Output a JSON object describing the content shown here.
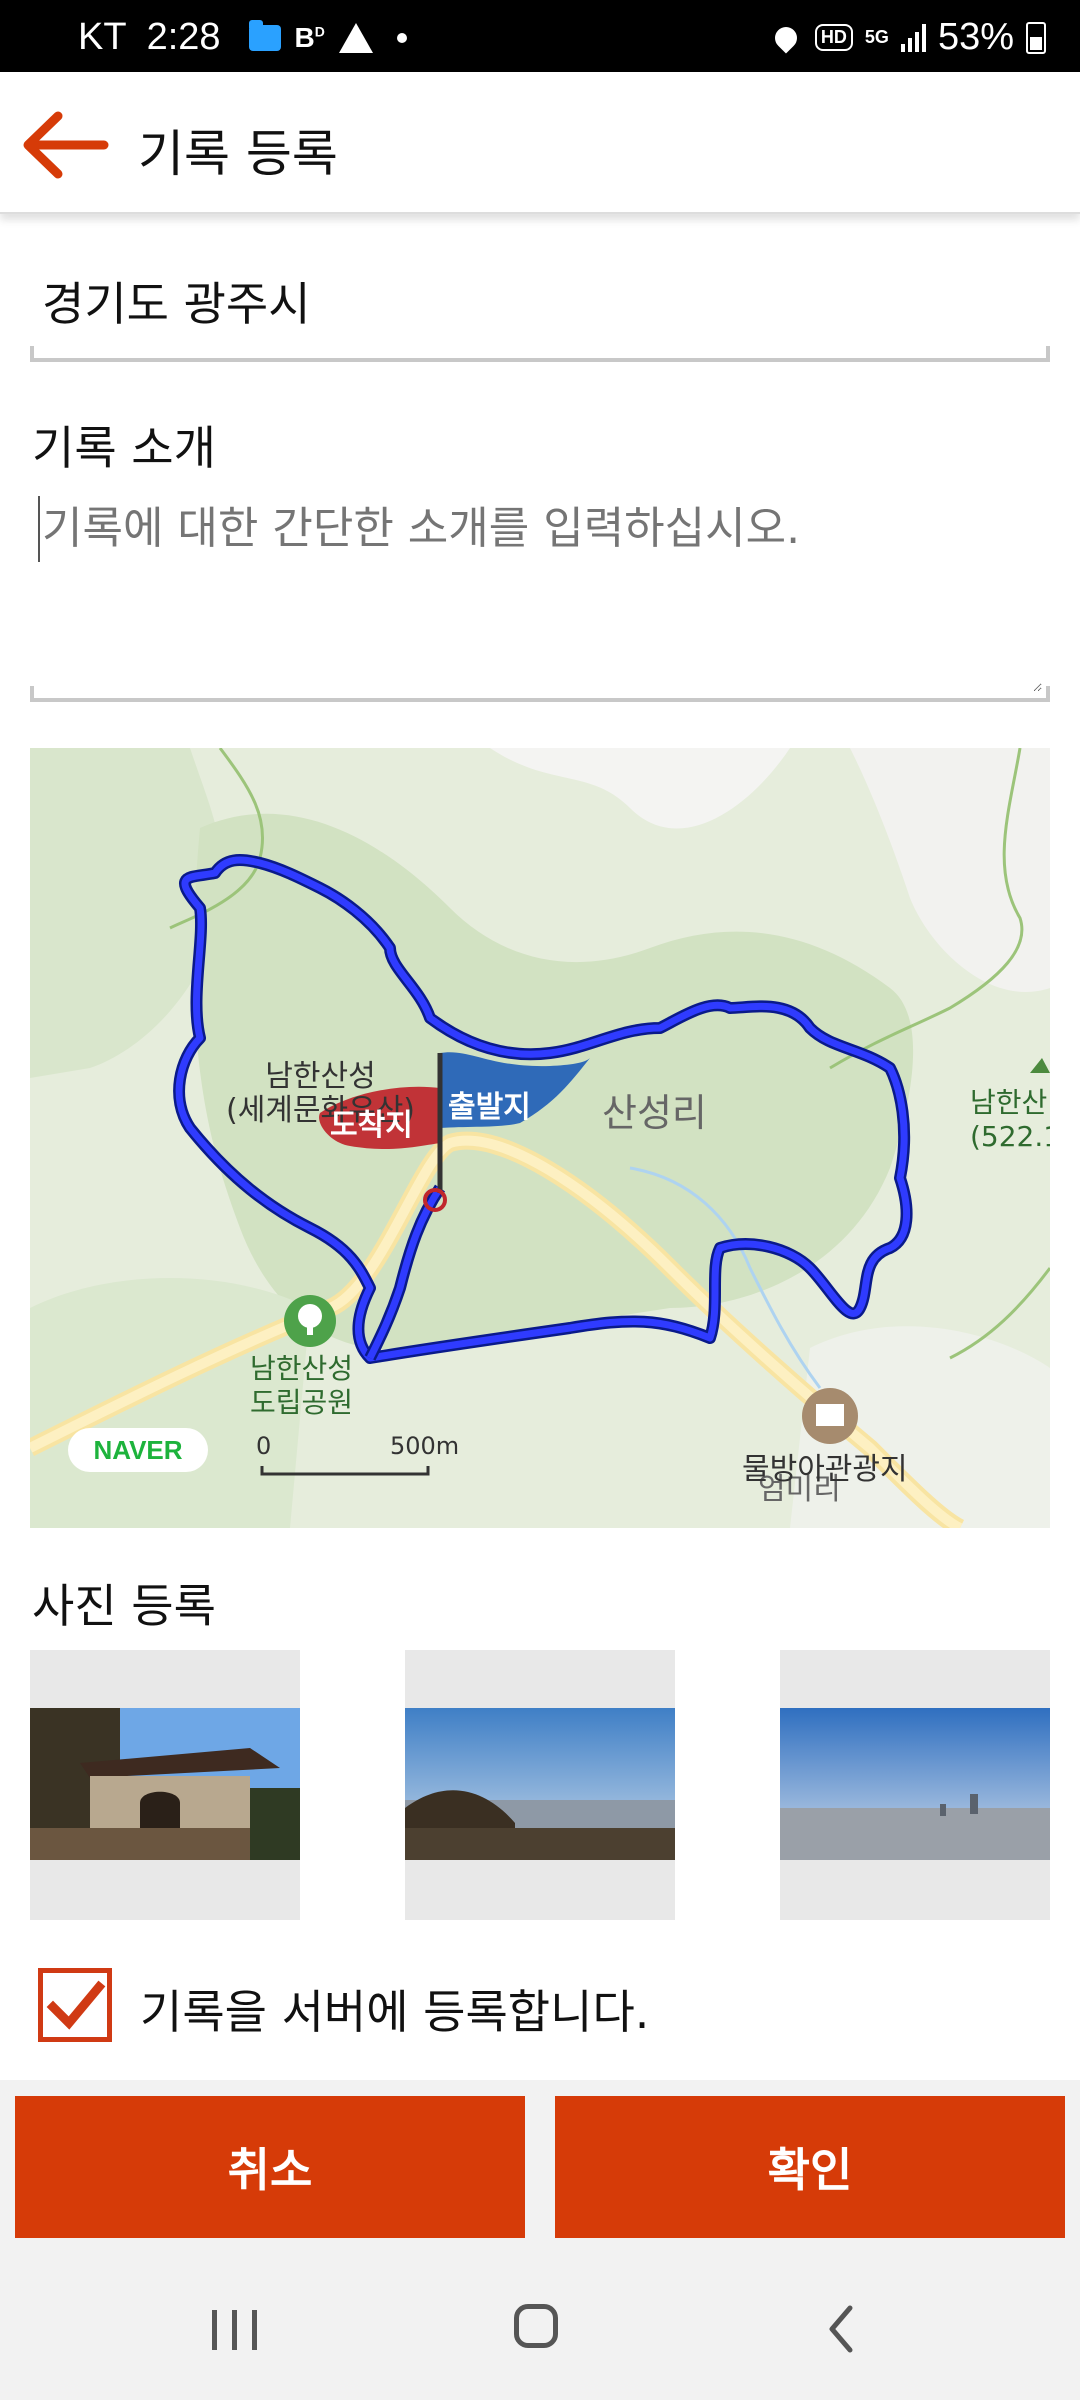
{
  "status_bar": {
    "carrier": "KT",
    "time": "2:28",
    "icons_left": [
      "folder-icon",
      "b-icon",
      "warning-icon",
      "dot-icon"
    ],
    "icons_right": [
      "location-icon",
      "hd-icon",
      "5g-icon",
      "signal-icon"
    ],
    "hd": "HD",
    "network": "5G",
    "battery": "53%"
  },
  "appbar": {
    "title": "기록 등록",
    "back_icon": "arrow-left-icon",
    "accent": "#d63b08"
  },
  "region": {
    "value": "경기도 광주시"
  },
  "intro": {
    "label": "기록 소개",
    "placeholder": "기록에 대한 간단한 소개를 입력하십시오."
  },
  "map": {
    "logo": "NAVER",
    "scale_start": "0",
    "scale_end": "500m",
    "start_flag": "출발지",
    "end_flag": "도착지",
    "places": {
      "fortress_line1": "남한산성",
      "fortress_line2": "(세계문화유산)",
      "village": "산성리",
      "park_line1": "남한산성",
      "park_line2": "도립공원",
      "mountain_line1": "남한산",
      "mountain_line2": "(522.1",
      "museum": "물방아관광지",
      "district": "엄미리"
    },
    "route_color": "#2f3bff"
  },
  "photos": {
    "label": "사진 등록",
    "items": [
      {
        "name": "photo-fortress-gate"
      },
      {
        "name": "photo-city-view-1"
      },
      {
        "name": "photo-city-view-2"
      }
    ]
  },
  "server_upload": {
    "label": "기록을 서버에 등록합니다.",
    "checked": true
  },
  "buttons": {
    "cancel": "취소",
    "confirm": "확인"
  },
  "navbar": {
    "recent_icon": "recent-apps-icon",
    "home_icon": "home-icon",
    "back_icon": "back-icon"
  }
}
